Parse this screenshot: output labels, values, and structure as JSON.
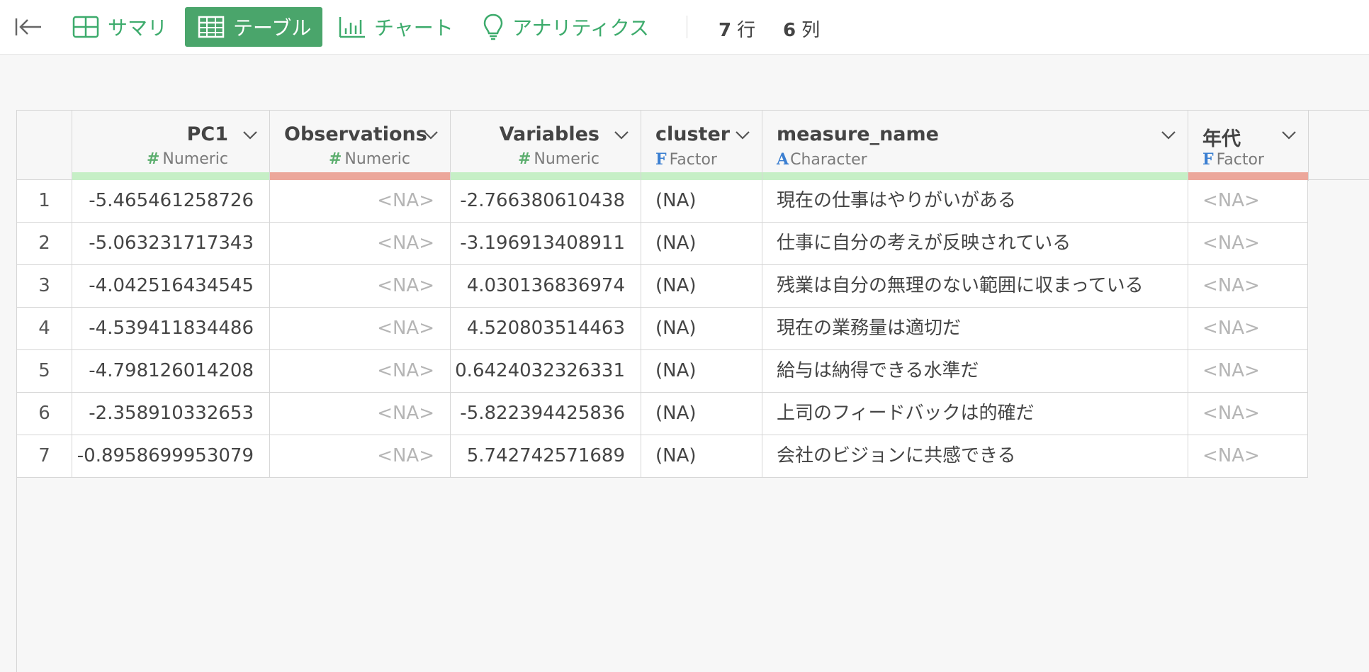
{
  "toolbar": {
    "tabs": [
      {
        "label": "サマリ",
        "active": false,
        "icon": "grid-icon"
      },
      {
        "label": "テーブル",
        "active": true,
        "icon": "table-icon"
      },
      {
        "label": "チャート",
        "active": false,
        "icon": "bar-chart-icon"
      },
      {
        "label": "アナリティクス",
        "active": false,
        "icon": "lightbulb-icon"
      }
    ],
    "rows_count": "7",
    "rows_unit": "行",
    "cols_count": "6",
    "cols_unit": "列"
  },
  "colors": {
    "accent": "#4aa56b",
    "quality_ok": "#c6efc6",
    "quality_missing": "#eca79b"
  },
  "table": {
    "columns": [
      {
        "name": "PC1",
        "type_symbol": "#",
        "type": "Numeric",
        "quality": "ok"
      },
      {
        "name": "Observations",
        "type_symbol": "#",
        "type": "Numeric",
        "quality": "missing"
      },
      {
        "name": "Variables",
        "type_symbol": "#",
        "type": "Numeric",
        "quality": "ok"
      },
      {
        "name": "cluster",
        "type_symbol": "F",
        "type": "Factor",
        "quality": "ok"
      },
      {
        "name": "measure_name",
        "type_symbol": "A",
        "type": "Character",
        "quality": "ok"
      },
      {
        "name": "年代",
        "type_symbol": "F",
        "type": "Factor",
        "quality": "missing"
      }
    ],
    "rows": [
      {
        "n": "1",
        "pc1": "-5.465461258726",
        "obs": "<NA>",
        "vars": "-2.766380610438",
        "cluster": "(NA)",
        "measure": "現在の仕事はやりがいがある",
        "age": "<NA>"
      },
      {
        "n": "2",
        "pc1": "-5.063231717343",
        "obs": "<NA>",
        "vars": "-3.196913408911",
        "cluster": "(NA)",
        "measure": "仕事に自分の考えが反映されている",
        "age": "<NA>"
      },
      {
        "n": "3",
        "pc1": "-4.042516434545",
        "obs": "<NA>",
        "vars": "4.030136836974",
        "cluster": "(NA)",
        "measure": "残業は自分の無理のない範囲に収まっている",
        "age": "<NA>"
      },
      {
        "n": "4",
        "pc1": "-4.539411834486",
        "obs": "<NA>",
        "vars": "4.520803514463",
        "cluster": "(NA)",
        "measure": "現在の業務量は適切だ",
        "age": "<NA>"
      },
      {
        "n": "5",
        "pc1": "-4.798126014208",
        "obs": "<NA>",
        "vars": "0.6424032326331",
        "cluster": "(NA)",
        "measure": "給与は納得できる水準だ",
        "age": "<NA>"
      },
      {
        "n": "6",
        "pc1": "-2.358910332653",
        "obs": "<NA>",
        "vars": "-5.822394425836",
        "cluster": "(NA)",
        "measure": "上司のフィードバックは的確だ",
        "age": "<NA>"
      },
      {
        "n": "7",
        "pc1": "-0.8958699953079",
        "obs": "<NA>",
        "vars": "5.742742571689",
        "cluster": "(NA)",
        "measure": "会社のビジョンに共感できる",
        "age": "<NA>"
      }
    ]
  }
}
